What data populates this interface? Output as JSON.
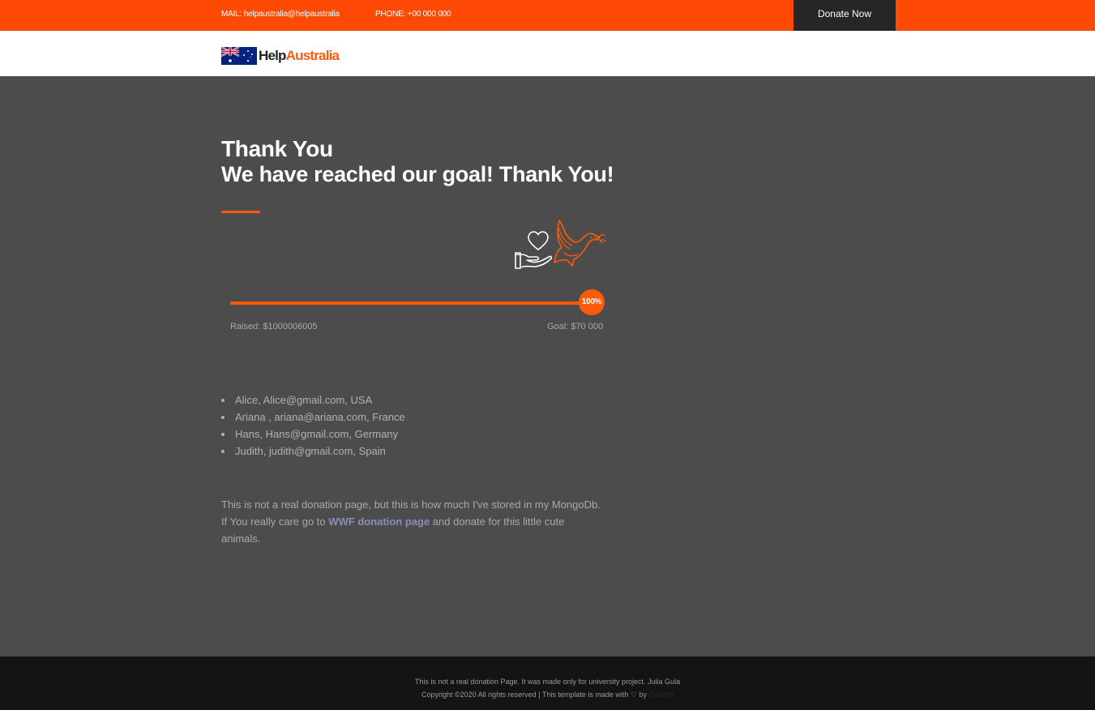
{
  "topbar": {
    "mail": "MAIL: helpaustralia@helpaustralia",
    "phone": "PHONE: +00 000 000",
    "donate_label": "Donate Now",
    "bg_color": "#ff4a05"
  },
  "brand": {
    "help": "Help",
    "australia": "Australia",
    "flag_icon": "australian-flag-icon"
  },
  "main": {
    "title": "Thank You",
    "subtitle": "We have reached our goal! Thank You!",
    "illustration_icon": "hand-heart-dove-icon",
    "progress": {
      "percent_value": 100,
      "percent_label": "100%",
      "raised": "Raised: $1000006005",
      "goal": "Goal: $70 000"
    },
    "donors": [
      "Alice, Alice@gmail.com, USA",
      "Ariana , ariana@ariana.com, France",
      "Hans, Hans@gmail.com, Germany",
      "Judith, judith@gmail.com, Spain"
    ],
    "note": {
      "before": "This is not a real donation page, but this is how much I've stored in my MongoDb. If You really care go to ",
      "link": "WWF donation page",
      "after": " and donate for this little cute animals."
    }
  },
  "footer": {
    "line1": "This is not a real donation Page. It was made only for university project. Julia Gula",
    "line2_before": "Copyright ©2020 All rights reserved | This template is made with ",
    "line2_by": " by ",
    "line2_link": "Colorlib"
  },
  "colors": {
    "accent": "#ff5a0a",
    "background": "#4c4c4c",
    "footer": "#141414"
  }
}
